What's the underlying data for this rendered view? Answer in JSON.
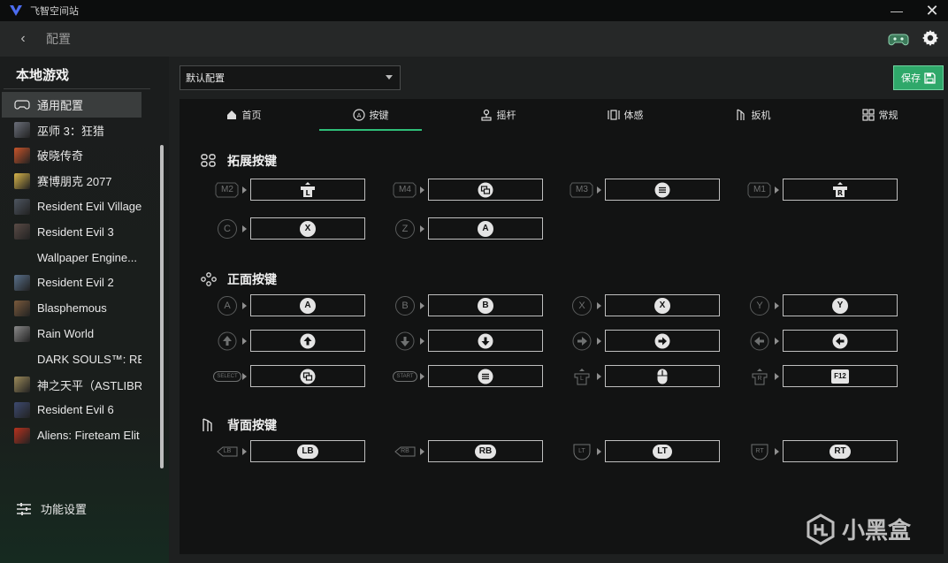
{
  "window": {
    "title": "飞智空间站",
    "minimize": "—",
    "close": "✕"
  },
  "header": {
    "back": "‹",
    "title": "配置"
  },
  "sidebar": {
    "title": "本地游戏",
    "games": [
      {
        "label": "通用配置",
        "icon": "gamepad-icon",
        "color": "",
        "active": true
      },
      {
        "label": "巫师 3：狂猎",
        "icon": "game-thumb",
        "color": "#6b6f7a"
      },
      {
        "label": "破晓传奇",
        "icon": "game-thumb",
        "color": "#c8542a"
      },
      {
        "label": "赛博朋克 2077",
        "icon": "game-thumb",
        "color": "#d7b54a"
      },
      {
        "label": "Resident Evil Village",
        "icon": "game-thumb",
        "color": "#4d5560"
      },
      {
        "label": "Resident Evil 3",
        "icon": "game-thumb",
        "color": "#5a4b46"
      },
      {
        "label": "Wallpaper Engine...",
        "icon": "",
        "color": ""
      },
      {
        "label": "Resident Evil 2",
        "icon": "game-thumb",
        "color": "#58708a"
      },
      {
        "label": "Blasphemous",
        "icon": "game-thumb",
        "color": "#7a5a3c"
      },
      {
        "label": "Rain World",
        "icon": "game-thumb",
        "color": "#8a8a8a"
      },
      {
        "label": "DARK SOULS™: RE...",
        "icon": "",
        "color": ""
      },
      {
        "label": "神之天平（ASTLIBR...",
        "icon": "game-thumb",
        "color": "#9b8a5a"
      },
      {
        "label": "Resident Evil 6",
        "icon": "game-thumb",
        "color": "#3d4a70"
      },
      {
        "label": "Aliens: Fireteam Elit",
        "icon": "game-thumb",
        "color": "#b8321e"
      }
    ],
    "footer": "功能设置"
  },
  "main": {
    "profile": "默认配置",
    "save": "保存",
    "tabs": [
      {
        "label": "首页",
        "icon": "home-icon"
      },
      {
        "label": "按键",
        "icon": "a-button-icon",
        "active": true
      },
      {
        "label": "摇杆",
        "icon": "joystick-icon"
      },
      {
        "label": "体感",
        "icon": "motion-icon"
      },
      {
        "label": "扳机",
        "icon": "trigger-icon"
      },
      {
        "label": "常规",
        "icon": "grid-icon"
      }
    ],
    "sections": {
      "extended": "拓展按键",
      "face": "正面按键",
      "back": "背面按键"
    },
    "extended_rows": [
      [
        {
          "src": "M2",
          "dst": "L"
        },
        {
          "src": "M4",
          "dst": "view"
        },
        {
          "src": "M3",
          "dst": "menu"
        },
        {
          "src": "M1",
          "dst": "R"
        }
      ],
      [
        {
          "src": "C",
          "dst": "X"
        },
        {
          "src": "Z",
          "dst": "A"
        }
      ]
    ],
    "face_rows": [
      [
        {
          "src": "A",
          "dst": "A"
        },
        {
          "src": "B",
          "dst": "B"
        },
        {
          "src": "X",
          "dst": "X"
        },
        {
          "src": "Y",
          "dst": "Y"
        }
      ],
      [
        {
          "src": "up",
          "dst": "up"
        },
        {
          "src": "down",
          "dst": "down"
        },
        {
          "src": "right",
          "dst": "right"
        },
        {
          "src": "left",
          "dst": "left"
        }
      ],
      [
        {
          "src": "SELECT",
          "dst": "view"
        },
        {
          "src": "START",
          "dst": "menu"
        },
        {
          "src": "L",
          "dst": "mouse"
        },
        {
          "src": "R",
          "dst": "F12"
        }
      ]
    ],
    "back_rows": [
      [
        {
          "src": "LB",
          "dst": "LB"
        },
        {
          "src": "RB",
          "dst": "RB"
        },
        {
          "src": "LT",
          "dst": "LT"
        },
        {
          "src": "RT",
          "dst": "RT"
        }
      ]
    ]
  },
  "watermark": "小黑盒",
  "colors": {
    "accent": "#2fbf78",
    "save_bg": "#2fa86a"
  }
}
